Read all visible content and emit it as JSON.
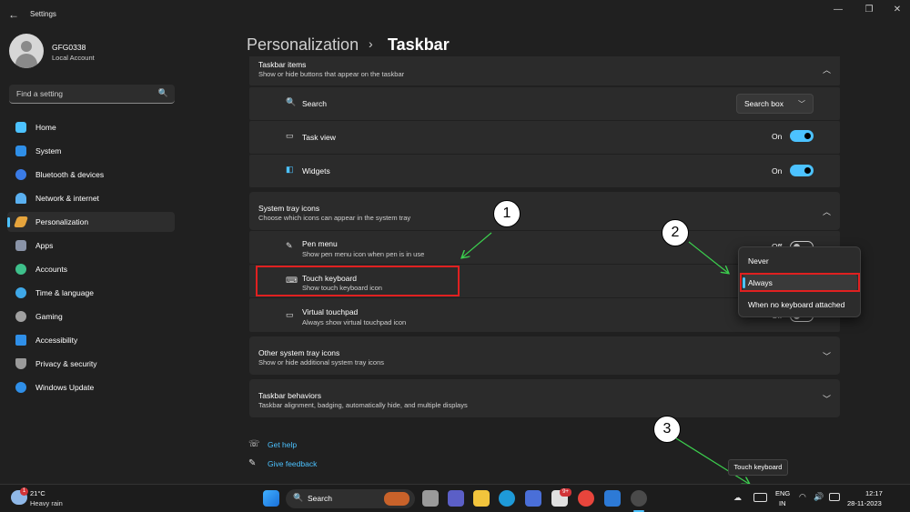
{
  "window": {
    "back_icon": "back-arrow-icon",
    "title": "Settings",
    "minimize": "—",
    "maximize": "❐",
    "close": "✕"
  },
  "user": {
    "name": "GFG0338",
    "account": "Local Account"
  },
  "search": {
    "placeholder": "Find a setting",
    "icon": "🔍"
  },
  "nav": [
    {
      "label": "Home",
      "color": "#4cc2ff"
    },
    {
      "label": "System",
      "color": "#2f8fe8"
    },
    {
      "label": "Bluetooth & devices",
      "color": "#3a7be6"
    },
    {
      "label": "Network & internet",
      "color": "#5ab0f0"
    },
    {
      "label": "Personalization",
      "color": "#e6a43c",
      "selected": true
    },
    {
      "label": "Apps",
      "color": "#8a94a8"
    },
    {
      "label": "Accounts",
      "color": "#3ec08b"
    },
    {
      "label": "Time & language",
      "color": "#3fa8e8"
    },
    {
      "label": "Gaming",
      "color": "#a0a0a0"
    },
    {
      "label": "Accessibility",
      "color": "#2f8fe8"
    },
    {
      "label": "Privacy & security",
      "color": "#9a9a9a"
    },
    {
      "label": "Windows Update",
      "color": "#2f8fe8"
    }
  ],
  "breadcrumb": {
    "parent": "Personalization",
    "separator": "›",
    "current": "Taskbar"
  },
  "taskbar_items": {
    "title": "Taskbar items",
    "subtitle": "Show or hide buttons that appear on the taskbar",
    "rows": [
      {
        "icon": "🔍",
        "label": "Search",
        "control": "select",
        "value": "Search box"
      },
      {
        "icon": "▭",
        "label": "Task view",
        "control": "toggle",
        "state": "On"
      },
      {
        "icon": "◧",
        "label": "Widgets",
        "control": "toggle",
        "state": "On"
      }
    ]
  },
  "system_tray": {
    "title": "System tray icons",
    "subtitle": "Choose which icons can appear in the system tray",
    "rows": [
      {
        "icon": "✎",
        "label": "Pen menu",
        "sub": "Show pen menu icon when pen is in use",
        "state": "Off"
      },
      {
        "icon": "⌨",
        "label": "Touch keyboard",
        "sub": "Show touch keyboard icon"
      },
      {
        "icon": "▭",
        "label": "Virtual touchpad",
        "sub": "Always show virtual touchpad icon",
        "state": "Off"
      }
    ]
  },
  "dropdown": {
    "options": [
      "Never",
      "Always",
      "When no keyboard attached"
    ],
    "selected": "Always"
  },
  "other_tray": {
    "title": "Other system tray icons",
    "subtitle": "Show or hide additional system tray icons"
  },
  "behaviors": {
    "title": "Taskbar behaviors",
    "subtitle": "Taskbar alignment, badging, automatically hide, and multiple displays"
  },
  "help": {
    "get_help": "Get help",
    "feedback": "Give feedback"
  },
  "annotations": {
    "one": "1",
    "two": "2",
    "three": "3"
  },
  "taskbar": {
    "weather_temp": "21°C",
    "weather_desc": "Heavy rain",
    "weather_badge": "1",
    "search_label": "Search",
    "badge_9plus": "9+",
    "tooltip": "Touch keyboard",
    "lang_top": "ENG",
    "lang_bottom": "IN",
    "time": "12:17",
    "date": "28-11-2023"
  }
}
